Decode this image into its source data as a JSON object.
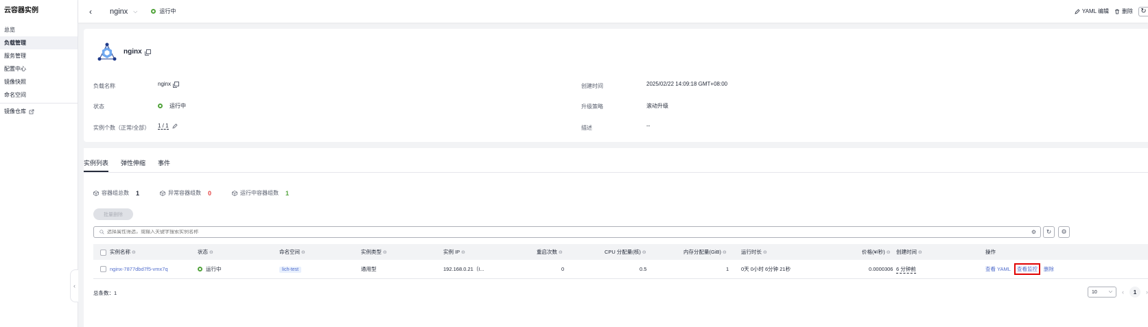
{
  "sidebar": {
    "title": "云容器实例",
    "items": [
      {
        "label": "总览"
      },
      {
        "label": "负载管理"
      },
      {
        "label": "服务管理"
      },
      {
        "label": "配置中心"
      },
      {
        "label": "镜像快照"
      },
      {
        "label": "命名空间"
      },
      {
        "label": "镜像仓库"
      }
    ]
  },
  "header": {
    "workload_name": "nginx",
    "status": "运行中",
    "yaml_edit": "YAML 编辑",
    "delete": "删除"
  },
  "detail": {
    "name": "nginx",
    "labels": {
      "workload_name": "负载名称",
      "status": "状态",
      "instance_count": "实例个数（正常/全部）",
      "created": "创建时间",
      "upgrade": "升级策略",
      "description": "描述"
    },
    "values": {
      "workload_name": "nginx",
      "status": "运行中",
      "instance_count": "1 / 1",
      "created": "2025/02/22 14:09:18 GMT+08:00",
      "upgrade": "滚动升级",
      "description": "--"
    }
  },
  "tabs": [
    "实例列表",
    "弹性伸缩",
    "事件"
  ],
  "stats": [
    {
      "label": "容器组总数",
      "value": "1",
      "color": "#252b3a"
    },
    {
      "label": "异常容器组数",
      "value": "0",
      "color": "#e54545"
    },
    {
      "label": "运行中容器组数",
      "value": "1",
      "color": "#50a33a"
    }
  ],
  "batch_delete": "批量删除",
  "search": {
    "placeholder": "选择属性筛选，或输入关键字搜索实例名称"
  },
  "table": {
    "columns": [
      "实例名称",
      "状态",
      "命名空间",
      "实例类型",
      "实例 IP",
      "重启次数",
      "CPU 分配量(核)",
      "内存分配量(GiB)",
      "运行时长",
      "价格(¥/秒)",
      "创建时间",
      "操作"
    ],
    "rows": [
      {
        "name": "nginx-7877dbd7f5-vmx7q",
        "status": "运行中",
        "namespace": "lich-test",
        "type": "通用型",
        "ip": "192.168.0.21（I...",
        "restarts": "0",
        "cpu": "0.5",
        "memory": "1",
        "runtime": "0天 0小时 6分钟 21秒",
        "price": "0.0000306",
        "created": "6 分钟前",
        "op_yaml": "查看 YAML",
        "op_monitor": "查看监控",
        "op_delete": "删除"
      }
    ]
  },
  "footer": {
    "total": "总条数：1",
    "page_size": "10",
    "page": "1"
  }
}
